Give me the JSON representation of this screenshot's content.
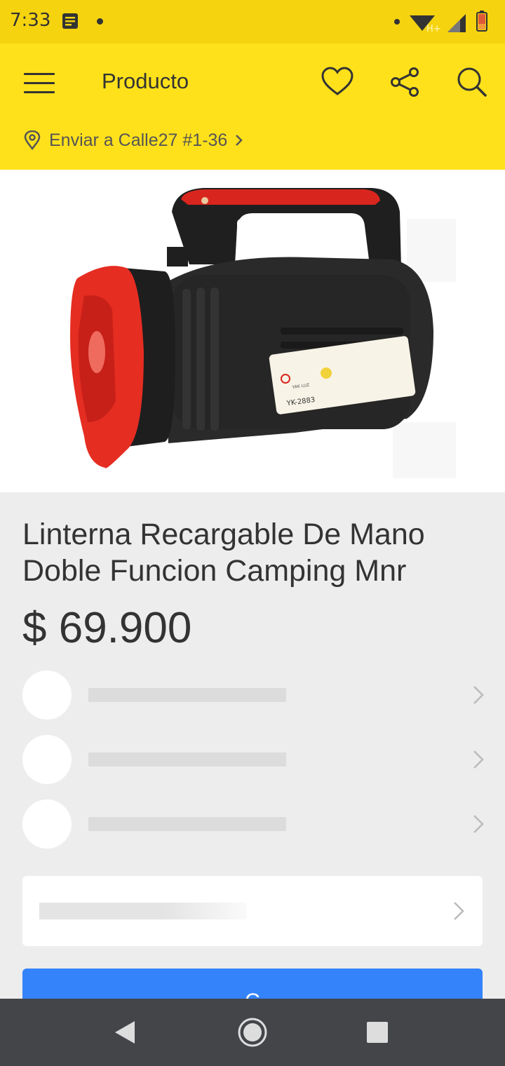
{
  "status_bar": {
    "time": "7:33",
    "network_type": "H+",
    "icons": [
      "notification-icon",
      "dot-icon",
      "wifi-icon",
      "signal-icon",
      "battery-icon"
    ]
  },
  "app_bar": {
    "title": "Producto",
    "menu_icon": "hamburger-menu-icon",
    "actions": [
      "heart-icon",
      "share-icon",
      "search-icon"
    ],
    "address_label": "Enviar a Calle27 #1-36",
    "background": "#ffe11b"
  },
  "product": {
    "title": "Linterna Recargable De Mano Doble Funcion Camping Mnr",
    "price": "$ 69.900",
    "image_label": "YK-2883",
    "image_brand": "YAK LUZ"
  },
  "buy_button": {
    "label": "C",
    "color": "#3483fa"
  },
  "nav_bar": {
    "buttons": [
      "back-icon",
      "home-icon",
      "recents-icon"
    ]
  }
}
